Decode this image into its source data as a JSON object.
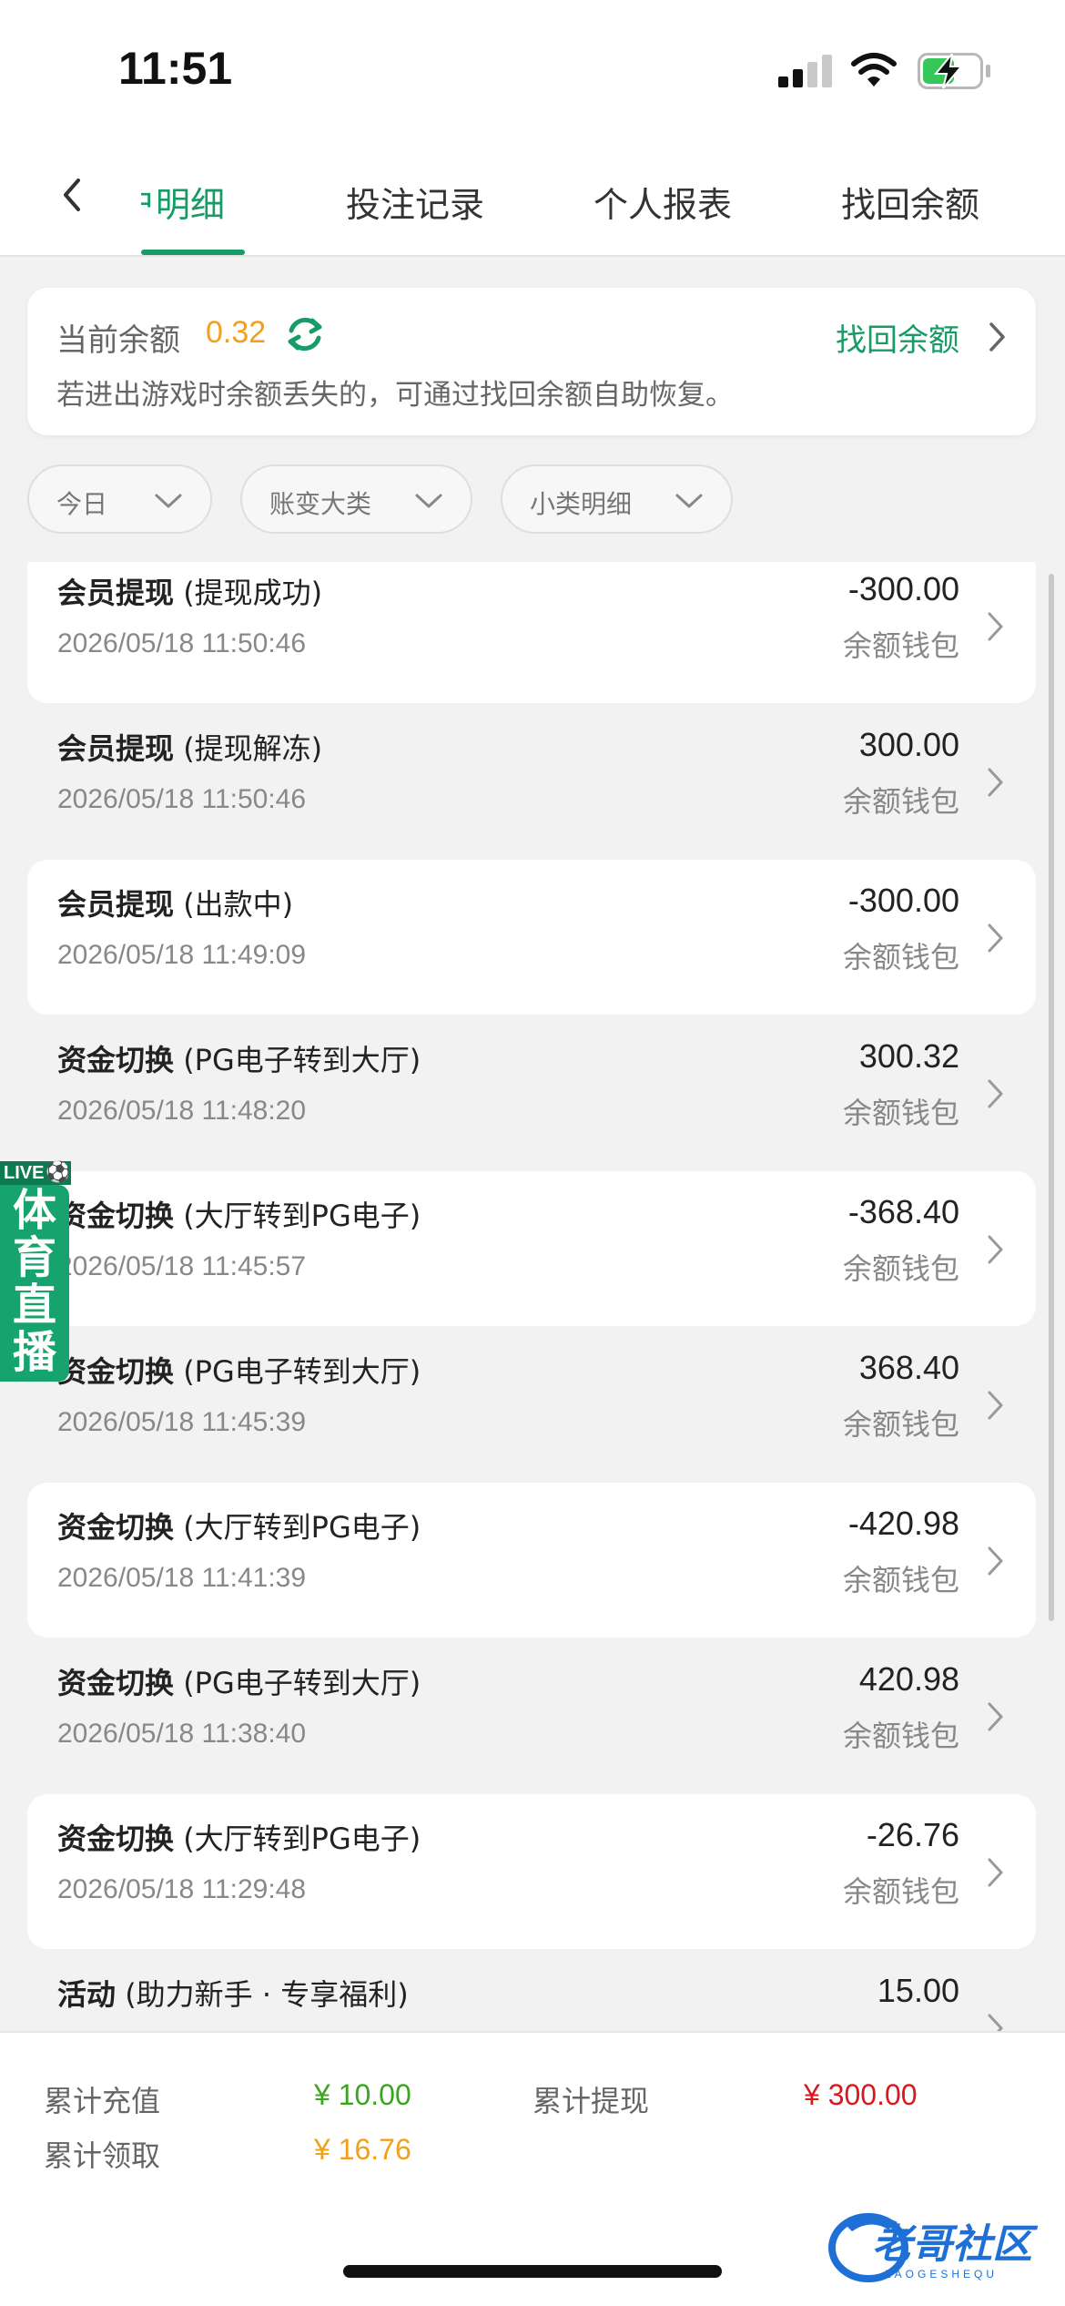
{
  "status_bar": {
    "time": "11:51"
  },
  "tabs": [
    {
      "label": "户明细",
      "active": true
    },
    {
      "label": "投注记录",
      "active": false
    },
    {
      "label": "个人报表",
      "active": false
    },
    {
      "label": "找回余额",
      "active": false
    }
  ],
  "balance": {
    "label": "当前余额",
    "value": "0.32",
    "recover_label": "找回余额",
    "hint": "若进出游戏时余额丢失的，可通过找回余额自助恢复。"
  },
  "filters": [
    {
      "label": "今日"
    },
    {
      "label": "账变大类"
    },
    {
      "label": "小类明细"
    }
  ],
  "records": [
    {
      "type": "会员提现",
      "detail": "(提现成功)",
      "time": "2026/05/18 11:50:46",
      "amount": "-300.00",
      "wallet": "余额钱包"
    },
    {
      "type": "会员提现",
      "detail": "(提现解冻)",
      "time": "2026/05/18 11:50:46",
      "amount": "300.00",
      "wallet": "余额钱包"
    },
    {
      "type": "会员提现",
      "detail": "(出款中)",
      "time": "2026/05/18 11:49:09",
      "amount": "-300.00",
      "wallet": "余额钱包"
    },
    {
      "type": "资金切换",
      "detail": "(PG电子转到大厅)",
      "time": "2026/05/18 11:48:20",
      "amount": "300.32",
      "wallet": "余额钱包"
    },
    {
      "type": "资金切换",
      "detail": "(大厅转到PG电子)",
      "time": "2026/05/18 11:45:57",
      "amount": "-368.40",
      "wallet": "余额钱包"
    },
    {
      "type": "资金切换",
      "detail": "(PG电子转到大厅)",
      "time": "2026/05/18 11:45:39",
      "amount": "368.40",
      "wallet": "余额钱包"
    },
    {
      "type": "资金切换",
      "detail": "(大厅转到PG电子)",
      "time": "2026/05/18 11:41:39",
      "amount": "-420.98",
      "wallet": "余额钱包"
    },
    {
      "type": "资金切换",
      "detail": "(PG电子转到大厅)",
      "time": "2026/05/18 11:38:40",
      "amount": "420.98",
      "wallet": "余额钱包"
    },
    {
      "type": "资金切换",
      "detail": "(大厅转到PG电子)",
      "time": "2026/05/18 11:29:48",
      "amount": "-26.76",
      "wallet": "余额钱包"
    },
    {
      "type": "活动",
      "detail": "(助力新手 · 专享福利)",
      "time": "",
      "amount": "15.00",
      "wallet": ""
    }
  ],
  "live_badge": {
    "tag": "LIVE",
    "chars": [
      "体",
      "育",
      "直",
      "播"
    ]
  },
  "summary": {
    "deposit_label": "累计充值",
    "deposit_value": "¥ 10.00",
    "withdraw_label": "累计提现",
    "withdraw_value": "¥ 300.00",
    "claim_label": "累计领取",
    "claim_value": "¥ 16.76"
  },
  "watermark": {
    "text": "老哥社区",
    "sub": "LAOGESHEQU"
  },
  "colors": {
    "accent": "#179b67",
    "balance": "#f0a01a",
    "deposit": "#3aa620",
    "withdraw": "#d8191f",
    "claim": "#f0a01a"
  }
}
